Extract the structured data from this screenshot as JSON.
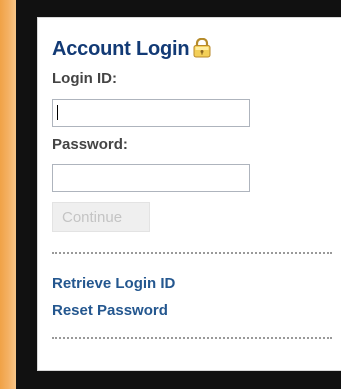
{
  "background": {
    "accent_color": "#f0a246",
    "frame_color": "#111111",
    "panel_color": "#ffffff"
  },
  "login_panel": {
    "title": "Account Login",
    "title_color": "#123a75",
    "lock_icon": "lock-icon",
    "login_id_label": "Login ID:",
    "login_id_value": "",
    "password_label": "Password:",
    "password_value": "",
    "continue_label": "Continue",
    "continue_disabled": true,
    "link_color": "#24578f",
    "links": [
      "Retrieve Login ID",
      "Reset Password"
    ]
  }
}
